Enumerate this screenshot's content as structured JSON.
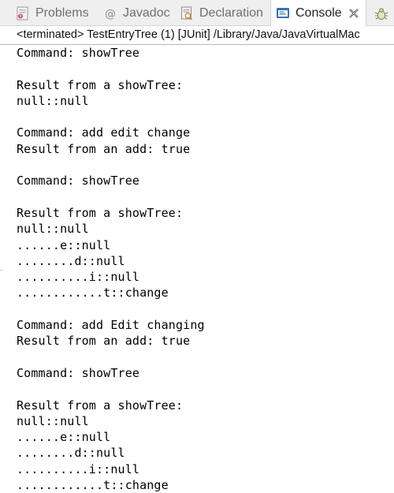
{
  "tabs": [
    {
      "label": "Problems",
      "icon": "problems-icon",
      "active": false
    },
    {
      "label": "Javadoc",
      "icon": "at-icon",
      "active": false
    },
    {
      "label": "Declaration",
      "icon": "declaration-icon",
      "active": false
    },
    {
      "label": "Console",
      "icon": "console-icon",
      "active": true
    },
    {
      "label": "",
      "icon": "debug-bug-icon",
      "active": false
    }
  ],
  "tab_close_glyph": "✕",
  "console_header": "<terminated> TestEntryTree (1) [JUnit] /Library/Java/JavaVirtualMac",
  "console_lines": [
    "Command: showTree",
    "",
    "Result from a showTree:",
    "null::null",
    "",
    "Command: add edit change",
    "Result from an add: true",
    "",
    "Command: showTree",
    "",
    "Result from a showTree:",
    "null::null",
    "......e::null",
    "........d::null",
    "..........i::null",
    "............t::change",
    "",
    "Command: add Edit changing",
    "Result from an add: true",
    "",
    "Command: showTree",
    "",
    "Result from a showTree:",
    "null::null",
    "......e::null",
    "........d::null",
    "..........i::null",
    "............t::change"
  ],
  "colors": {
    "tab_bar_bg": "#efefef",
    "active_tab_bg": "#ffffff",
    "console_icon_blue": "#3b6fb5",
    "text": "#000000"
  }
}
